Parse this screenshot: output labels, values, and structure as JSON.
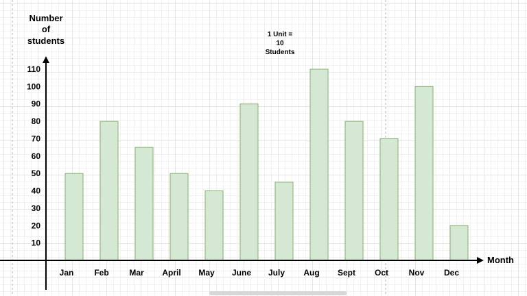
{
  "chart_data": {
    "type": "bar",
    "categories": [
      "Jan",
      "Feb",
      "Mar",
      "April",
      "May",
      "June",
      "July",
      "Aug",
      "Sept",
      "Oct",
      "Nov",
      "Dec"
    ],
    "values": [
      50,
      80,
      65,
      50,
      40,
      90,
      45,
      110,
      80,
      70,
      100,
      20
    ],
    "y_ticks": [
      10,
      20,
      30,
      40,
      50,
      60,
      70,
      80,
      90,
      100,
      110
    ],
    "ylabel_lines": [
      "Number",
      "of",
      "students"
    ],
    "xlabel": "Month",
    "note_lines": [
      "1 Unit =",
      "10",
      "Students"
    ],
    "ylim": [
      0,
      110
    ],
    "grid": true,
    "colors": {
      "bar_fill": "#d5e8d4",
      "bar_stroke": "#82b366",
      "axis": "#000000",
      "guide_line": "#b3b3b3"
    }
  }
}
